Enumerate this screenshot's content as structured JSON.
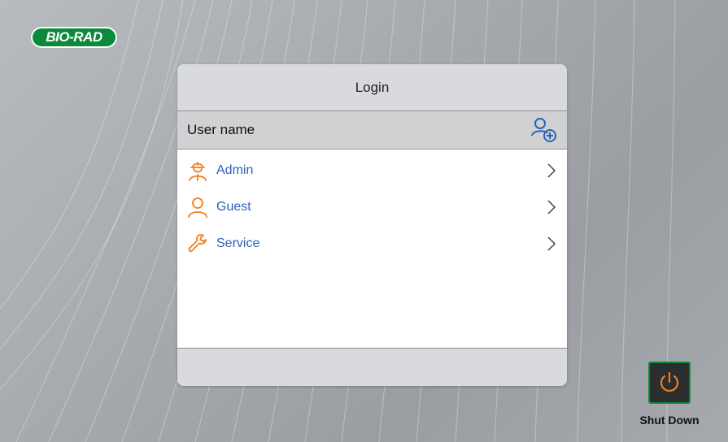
{
  "logo": {
    "text": "BIO-RAD",
    "color": "#0a8a3a"
  },
  "login_dialog": {
    "title": "Login",
    "username_label": "User name",
    "add_user_icon": "add-user-icon",
    "users": [
      {
        "name": "Admin",
        "icon": "admin-user-icon"
      },
      {
        "name": "Guest",
        "icon": "guest-user-icon"
      },
      {
        "name": "Service",
        "icon": "wrench-icon"
      }
    ]
  },
  "shutdown": {
    "label": "Shut Down",
    "icon": "power-icon"
  },
  "colors": {
    "accent": "#2a62b8",
    "icon_orange": "#f07f1f",
    "brand_green": "#0a8a3a"
  }
}
